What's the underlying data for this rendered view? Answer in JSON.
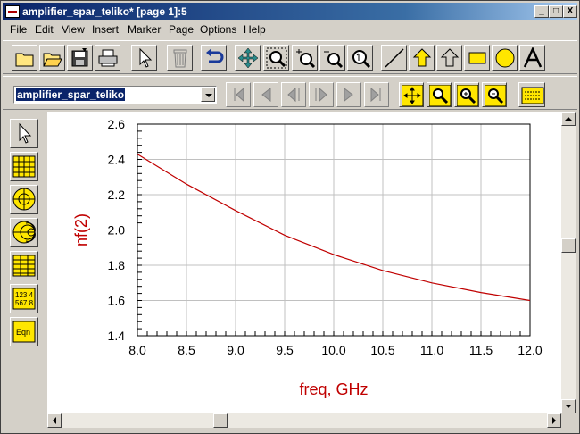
{
  "window": {
    "title": "amplifier_spar_teliko* [page 1]:5",
    "controls": {
      "minimize": "_",
      "maximize": "□",
      "close": "X"
    }
  },
  "menu": [
    "File",
    "Edit",
    "View",
    "Insert",
    "Marker",
    "Page",
    "Options",
    "Help"
  ],
  "toolbar": {
    "buttons": [
      "new-folder",
      "open-folder",
      "save",
      "print",
      "select-arrow",
      "delete-trash",
      "undo",
      "move",
      "zoom-area",
      "zoom-in",
      "zoom-out",
      "zoom-one",
      "line",
      "polygon",
      "polyline",
      "rectangle",
      "circle",
      "text"
    ]
  },
  "page_selector": {
    "value": "amplifier_spar_teliko"
  },
  "nav_buttons": [
    "first-page",
    "previous-page",
    "previous",
    "next",
    "next-page",
    "last-page"
  ],
  "view_buttons": [
    "view-all",
    "zoom-view",
    "zoom-in-view",
    "zoom-out-view",
    "display-options"
  ],
  "palette": [
    "pointer",
    "rectangular-plot",
    "polar-plot",
    "smith-chart",
    "list",
    "stack",
    "equation"
  ],
  "palette_labels": {
    "stack": "123 4\n567 8",
    "equation": "Eqn"
  },
  "colors": {
    "trace": "#c00000",
    "axis_label": "#c00000",
    "grid": "#c0c0c0",
    "title_bar": "#0a246a"
  },
  "chart_data": {
    "type": "line",
    "xlabel": "freq, GHz",
    "ylabel": "nf(2)",
    "xlim": [
      8.0,
      12.0
    ],
    "ylim": [
      1.4,
      2.6
    ],
    "xticks": [
      "8.0",
      "8.5",
      "9.0",
      "9.5",
      "10.0",
      "10.5",
      "11.0",
      "11.5",
      "12.0"
    ],
    "yticks": [
      "1.4",
      "1.6",
      "1.8",
      "2.0",
      "2.2",
      "2.4",
      "2.6"
    ],
    "grid": true,
    "series": [
      {
        "x": [
          8.0,
          8.5,
          9.0,
          9.5,
          10.0,
          10.5,
          11.0,
          11.5,
          12.0
        ],
        "y": [
          2.43,
          2.26,
          2.11,
          1.97,
          1.86,
          1.77,
          1.7,
          1.645,
          1.6
        ]
      }
    ]
  }
}
